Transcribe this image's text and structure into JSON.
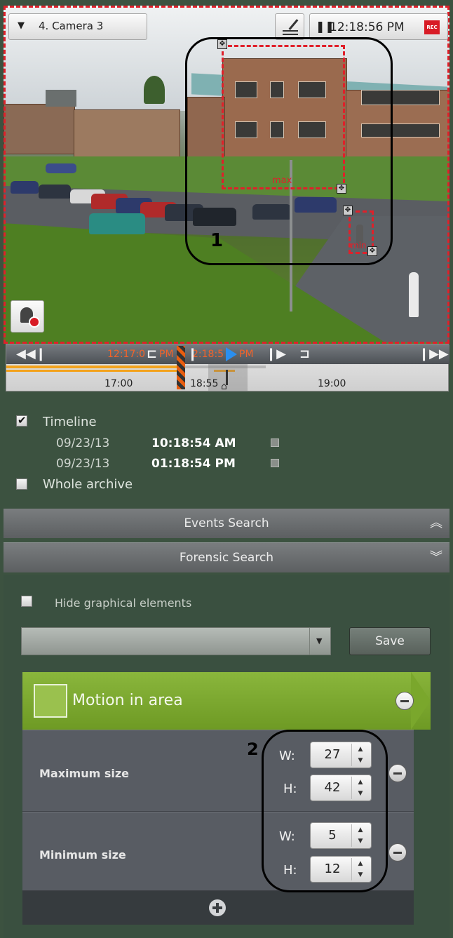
{
  "camera": {
    "name": "4. Camera 3",
    "time": "12:18:56 PM",
    "rec_badge": "REC",
    "callout_1": "1",
    "zone_max_label": "max",
    "zone_min_label": "min"
  },
  "timeline": {
    "marker_time_left": "12:17:0",
    "marker_time_left_suffix": "PM",
    "marker_time_right": "2:18:5",
    "marker_time_right_suffix": "PM",
    "tick_labels": [
      "17:00",
      "18:55",
      "19:00"
    ]
  },
  "filters": {
    "timeline_checkbox_label": "Timeline",
    "timeline_checked": true,
    "start_date": "09/23/13",
    "start_time": "10:18:54 AM",
    "end_date": "09/23/13",
    "end_time": "01:18:54 PM",
    "whole_archive_label": "Whole archive",
    "whole_archive_checked": false
  },
  "sections": {
    "events_search": "Events Search",
    "forensic_search": "Forensic Search"
  },
  "forensic": {
    "hide_graphical_label": "Hide graphical elements",
    "hide_graphical_checked": false,
    "preset_value": "",
    "save_label": "Save",
    "condition_title": "Motion in area",
    "callout_2": "2",
    "maximum": {
      "label": "Maximum size",
      "w_label": "W:",
      "w": "27",
      "h_label": "H:",
      "h": "42"
    },
    "minimum": {
      "label": "Minimum size",
      "w_label": "W:",
      "w": "5",
      "h_label": "H:",
      "h": "12"
    }
  },
  "colors": {
    "panel_bg": "#3c5240",
    "condition_green": "#7ea92e",
    "zone_red": "#e0202a",
    "timeline_orange": "#f3a21c",
    "play_blue": "#2a8ff0"
  }
}
